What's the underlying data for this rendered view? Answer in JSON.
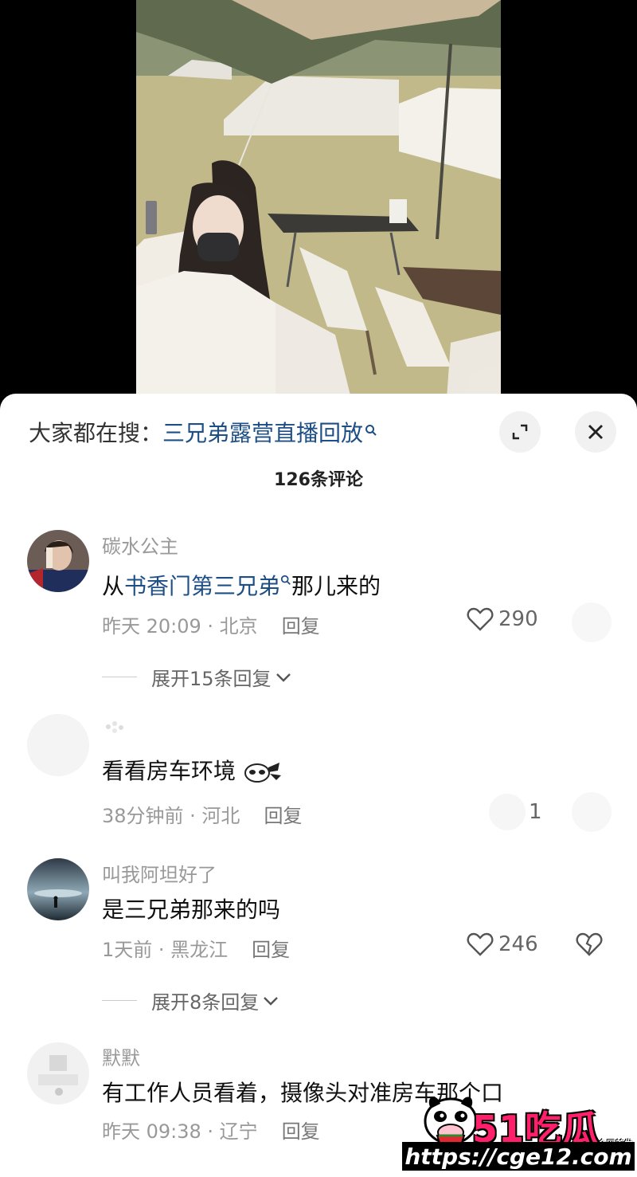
{
  "search": {
    "prefix": "大家都在搜：",
    "query": "三兄弟露营直播回放",
    "query_icon": "search-icon"
  },
  "comment_count": "126条评论",
  "comments": [
    {
      "username": "碳水公主",
      "text_plain_before": "从",
      "text_link": "书香门第三兄弟",
      "text_plain_after": "那儿来的",
      "time": "昨天 20:09 · 北京",
      "reply": "回复",
      "likes": "290",
      "expand": "展开15条回复"
    },
    {
      "username": "",
      "text": "看看房车环境",
      "time": "38分钟前 · 河北",
      "reply": "回复",
      "likes": "1"
    },
    {
      "username": "叫我阿坦好了",
      "text": "是三兄弟那来的吗",
      "time": "1天前 · 黑龙江",
      "reply": "回复",
      "likes": "246",
      "expand": "展开8条回复"
    },
    {
      "username": "默默",
      "text": "有工作人员看着，摄像头对准房车那个口",
      "time": "昨天 09:38 · 辽宁",
      "reply": "回复"
    }
  ],
  "watermark": {
    "brand": "51吃瓜",
    "tag": "全网首发",
    "url": "https://cge12.com"
  },
  "colors": {
    "link": "#1d4f86",
    "watermark_pink": "#ff1f6b"
  }
}
